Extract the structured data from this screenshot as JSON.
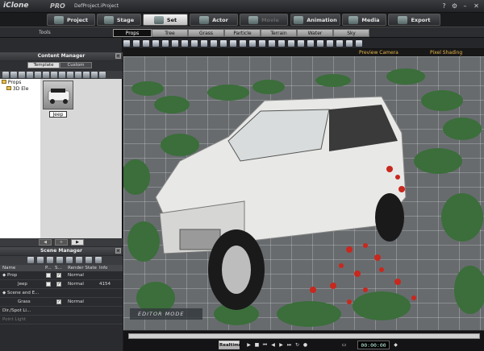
{
  "app": {
    "logo_text": "iClone",
    "edition": "PRO",
    "project": "DefProject.iProject"
  },
  "window_controls": [
    "?",
    "⚙",
    "–",
    "✕"
  ],
  "main_tabs": [
    {
      "label": "Project",
      "state": "normal"
    },
    {
      "label": "Stage",
      "state": "normal"
    },
    {
      "label": "Set",
      "state": "active"
    },
    {
      "label": "Actor",
      "state": "normal"
    },
    {
      "label": "Movie",
      "state": "disabled"
    },
    {
      "label": "Animation",
      "state": "normal"
    },
    {
      "label": "Media",
      "state": "normal"
    },
    {
      "label": "Export",
      "state": "normal"
    }
  ],
  "subbar": {
    "tools_label": "Tools",
    "tabs": [
      "Props",
      "Tree",
      "Grass",
      "Particle",
      "Terrain",
      "Water",
      "Sky"
    ],
    "active": "Props"
  },
  "content_manager": {
    "title": "Content Manager",
    "tabs": [
      "Template",
      "Custom"
    ],
    "active_tab": "Template",
    "tree": [
      {
        "label": "Props"
      },
      {
        "label": "3D Ele"
      }
    ],
    "item": {
      "label": "Jeep"
    }
  },
  "scene_manager": {
    "title": "Scene Manager",
    "columns": [
      "Name",
      "P...",
      "S...",
      "Render State",
      "Info"
    ],
    "rows": [
      {
        "name": "Prop",
        "p": false,
        "s": true,
        "state": "Normal",
        "info": ""
      },
      {
        "name": "Jeep",
        "p": false,
        "s": true,
        "state": "Normal",
        "info": "4154"
      },
      {
        "name": "Scene and E...",
        "p": false,
        "s": false,
        "state": "",
        "info": ""
      },
      {
        "name": "Grass",
        "p": false,
        "s": true,
        "state": "Normal",
        "info": ""
      },
      {
        "name": "Dir./Spot Li...",
        "p": false,
        "s": false,
        "state": "",
        "info": ""
      },
      {
        "name": "Point Light",
        "p": false,
        "s": false,
        "state": "",
        "info": ""
      }
    ]
  },
  "viewport": {
    "camera_labels": [
      "Preview Camera",
      "Pixel Shading"
    ],
    "mode_label": "EDITOR MODE"
  },
  "timeline": {
    "realtime_label": "Realtime",
    "timecode": "00:00:00"
  },
  "colors": {
    "accent_orange": "#e8b64a",
    "flower_red": "#c8281e",
    "grass_green": "#3f7a3a",
    "jeep_body": "#e8e8e6"
  }
}
